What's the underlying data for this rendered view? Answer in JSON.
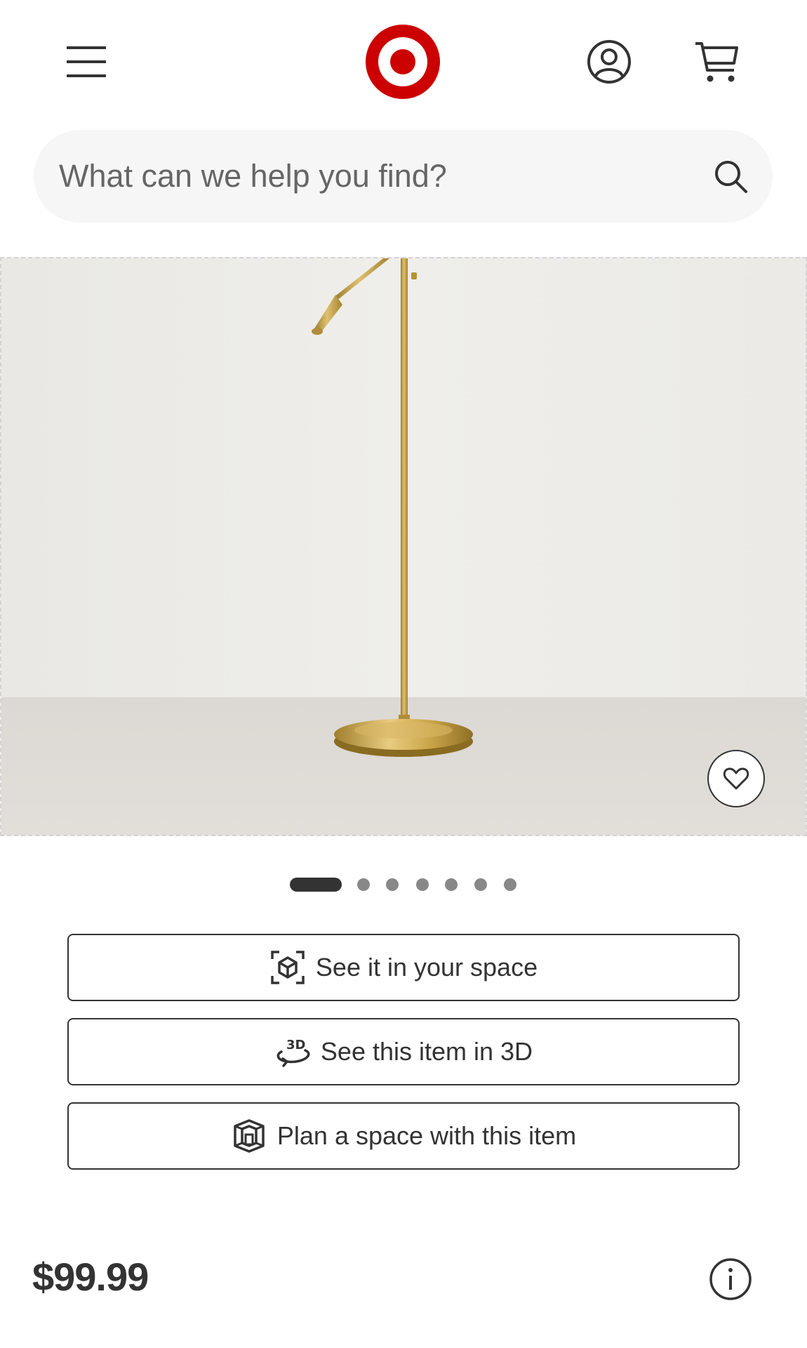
{
  "header": {
    "menu_icon": "hamburger-menu-icon",
    "logo_icon": "target-bullseye-logo",
    "account_icon": "account-icon",
    "cart_icon": "cart-icon",
    "brand_color": "#cc0000"
  },
  "search": {
    "placeholder": "What can we help you find?",
    "value": "",
    "icon": "search-icon"
  },
  "product": {
    "image_alt": "gold-floor-lamp-image",
    "favorite_icon": "heart-icon",
    "carousel": {
      "total": 7,
      "active_index": 0
    }
  },
  "actions": [
    {
      "label": "See it in your space",
      "icon": "ar-cube-icon"
    },
    {
      "label": "See this item in 3D",
      "icon": "3d-rotate-icon"
    },
    {
      "label": "Plan a space with this item",
      "icon": "room-plan-icon"
    }
  ],
  "price": {
    "value": "$99.99",
    "info_icon": "info-icon"
  }
}
